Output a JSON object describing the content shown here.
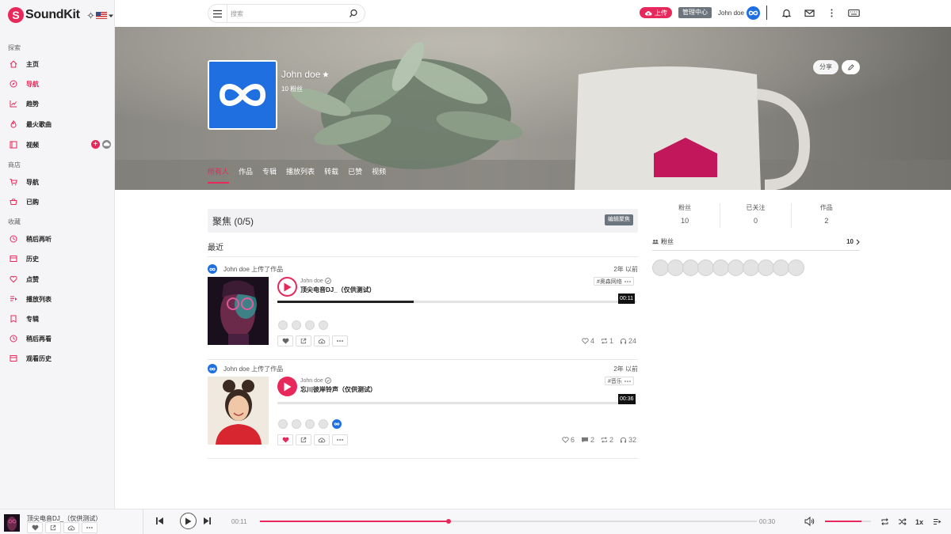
{
  "app": {
    "logo_text": "SoundKit"
  },
  "sidebar": {
    "sections": {
      "discover": "探索",
      "shop": "商店",
      "collection": "收藏"
    },
    "items": [
      {
        "label": "主页",
        "icon": "home-icon"
      },
      {
        "label": "导航",
        "icon": "compass-icon",
        "active": true
      },
      {
        "label": "趋势",
        "icon": "chart-icon"
      },
      {
        "label": "最火歌曲",
        "icon": "fire-icon"
      },
      {
        "label": "视频",
        "icon": "video-icon"
      },
      {
        "label": "导航",
        "icon": "cart-icon"
      },
      {
        "label": "已购",
        "icon": "basket-icon"
      },
      {
        "label": "稍后再听",
        "icon": "clock-icon"
      },
      {
        "label": "历史",
        "icon": "history-icon"
      },
      {
        "label": "点赞",
        "icon": "heart-icon"
      },
      {
        "label": "播放列表",
        "icon": "playlist-icon"
      },
      {
        "label": "专辑",
        "icon": "album-icon"
      },
      {
        "label": "稍后再看",
        "icon": "clock-icon"
      },
      {
        "label": "观看历史",
        "icon": "history-icon"
      }
    ]
  },
  "topbar": {
    "search_placeholder": "搜索",
    "upload_label": "上传",
    "admin_label": "管理中心",
    "username": "John doe"
  },
  "profile": {
    "name": "John doe",
    "fans": "10 粉丝",
    "share_label": "分享",
    "tabs": [
      "所有人",
      "作品",
      "专辑",
      "播放列表",
      "转载",
      "已赞",
      "视频"
    ],
    "active_tab": 0
  },
  "spotlight": {
    "title": "聚焦 (0/5)",
    "edit_label": "编辑聚焦"
  },
  "recent_label": "最近",
  "feed": [
    {
      "header": "John doe 上传了作品",
      "time": "2年 以前",
      "artist": "John doe",
      "title": "顶尖电音DJ_（仅供测试）",
      "tag": "#奥森网络",
      "duration": "00:11",
      "progress": 0.38,
      "stats": {
        "likes": "4",
        "reposts": "1",
        "plays": "24"
      }
    },
    {
      "header": "John doe 上传了作品",
      "time": "2年 以前",
      "artist": "John doe",
      "title": "忘川彼岸铃声（仅供测试）",
      "tag": "#音乐",
      "duration": "00:36",
      "progress": 0,
      "stats": {
        "likes": "6",
        "comments": "2",
        "reposts": "2",
        "plays": "32"
      }
    }
  ],
  "right_panel": {
    "stats": [
      {
        "label": "粉丝",
        "value": "10"
      },
      {
        "label": "已关注",
        "value": "0"
      },
      {
        "label": "作品",
        "value": "2"
      }
    ],
    "fans_label": "粉丝",
    "fans_count": "10"
  },
  "player": {
    "title": "顶尖电音DJ_（仅供测试）",
    "current": "00:11",
    "total": "00:30",
    "progress": 0.38,
    "volume": 0.8,
    "rate": "1x"
  },
  "colors": {
    "accent": "#e8285a",
    "brand_blue": "#1f6fe0"
  }
}
